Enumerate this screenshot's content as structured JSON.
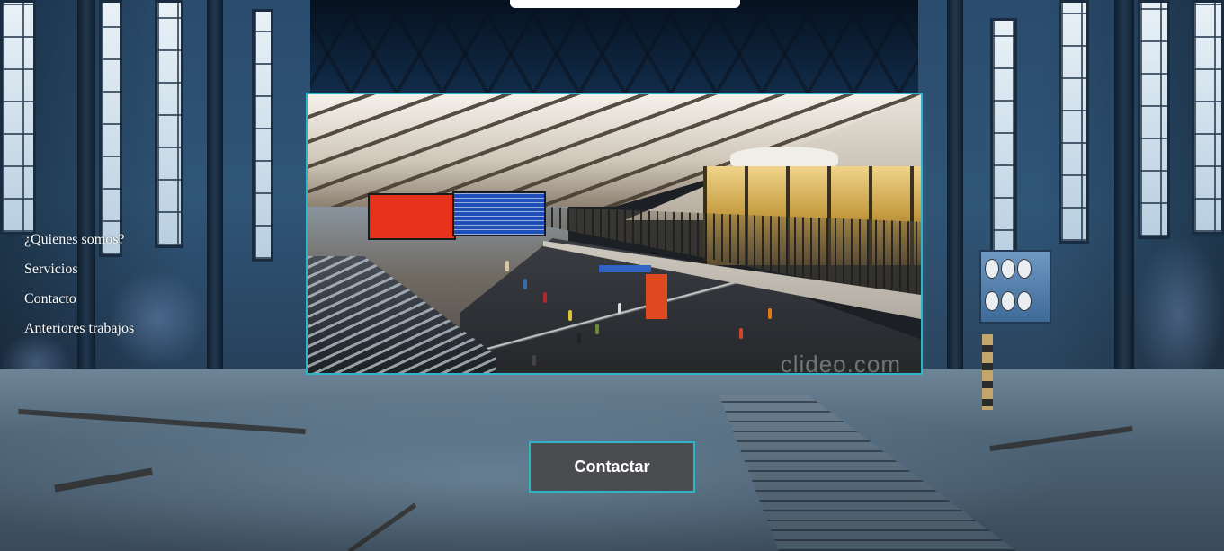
{
  "nav": {
    "items": [
      {
        "label": "¿Quienes somos?"
      },
      {
        "label": "Servicios"
      },
      {
        "label": "Contacto"
      },
      {
        "label": "Anteriores trabajos"
      }
    ]
  },
  "video": {
    "watermark": "clideo.com"
  },
  "cta": {
    "label": "Contactar"
  },
  "colors": {
    "accent_border": "#2fb4c9",
    "button_bg": "#4a4c4f",
    "nav_text": "#ffffff"
  }
}
